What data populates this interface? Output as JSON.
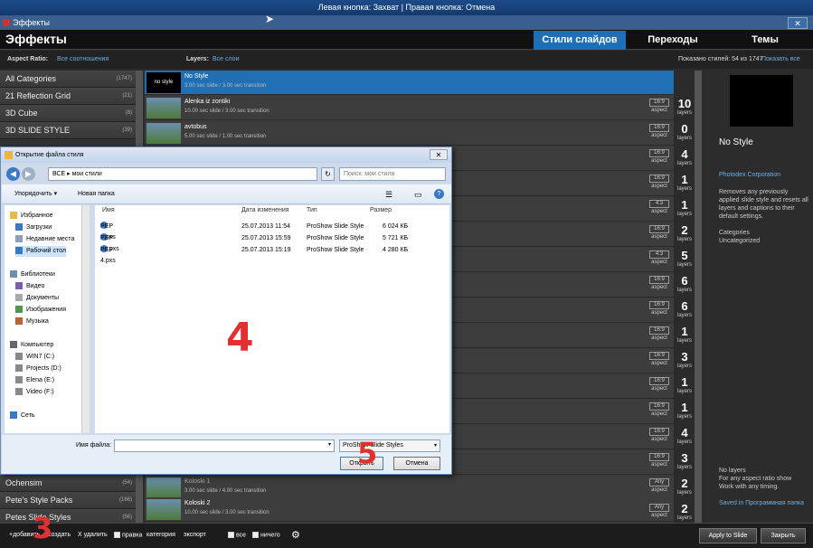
{
  "capture_banner": "Левая кнопка: Захват | Правая кнопка: Отмена",
  "window_title": "Эффекты",
  "header": {
    "title": "Эффекты",
    "tabs": [
      "Стили слайдов",
      "Переходы",
      "Темы"
    ]
  },
  "subheader": {
    "aspect_label": "Aspect Ratio:",
    "aspect_value": "Все соотношения",
    "layers_label": "Layers:",
    "layers_value": "Все слои",
    "shown_text": "Показано стилей: 54 из 1747",
    "show_all": "Показать все"
  },
  "categories": [
    {
      "label": "All Categories",
      "count": "(1747)"
    },
    {
      "label": "21 Reflection Grid",
      "count": "(21)"
    },
    {
      "label": "3D Cube",
      "count": "(8)"
    },
    {
      "label": "3D SLIDE STYLE",
      "count": "(39)"
    },
    {
      "label": "Ochensim",
      "count": "(54)"
    },
    {
      "label": "Pete's Style Packs",
      "count": "(166)"
    },
    {
      "label": "Petes Slide Styles",
      "count": "(56)"
    }
  ],
  "styles": [
    {
      "name": "No Style",
      "info": "3.00 sec slide / 3.00 sec transition",
      "thumb": "no style"
    },
    {
      "name": "Alenka iz zontiki",
      "info": "10.00 sec slide / 3.00 sec transition"
    },
    {
      "name": "avtobus",
      "info": "5.00 sec slide / 1.00 sec transition"
    },
    {
      "name": "Koloski 1",
      "info": "3.00 sec slide / 4.00 sec transition"
    },
    {
      "name": "Koloski 2",
      "info": "10.00 sec slide / 3.00 sec transition"
    }
  ],
  "layer_rows": [
    {
      "aspect": "",
      "layers": ""
    },
    {
      "aspect": "16:9",
      "layers": "10"
    },
    {
      "aspect": "16:9",
      "layers": "0"
    },
    {
      "aspect": "16:9",
      "layers": "4"
    },
    {
      "aspect": "16:9",
      "layers": "1"
    },
    {
      "aspect": "4:3",
      "layers": "1"
    },
    {
      "aspect": "16:9",
      "layers": "2"
    },
    {
      "aspect": "4:3",
      "layers": "5"
    },
    {
      "aspect": "16:9",
      "layers": "6"
    },
    {
      "aspect": "16:9",
      "layers": "6"
    },
    {
      "aspect": "16:9",
      "layers": "1"
    },
    {
      "aspect": "16:9",
      "layers": "3"
    },
    {
      "aspect": "16:9",
      "layers": "1"
    },
    {
      "aspect": "16:9",
      "layers": "1"
    },
    {
      "aspect": "16:9",
      "layers": "4"
    },
    {
      "aspect": "16:9",
      "layers": "3"
    },
    {
      "aspect": "Any",
      "layers": "2"
    },
    {
      "aspect": "Any",
      "layers": "2"
    }
  ],
  "aspect_word": "aspect",
  "layers_word": "layers",
  "preview": {
    "name": "No Style",
    "author": "Photodex Corporation",
    "description": "Removes any previously applied slide style and resets all layers and captions to their default settings.",
    "categories_label": "Categories",
    "category": "Uncategorized",
    "layers_info": [
      "No layers",
      "For any aspect ratio show",
      "Work with any timing."
    ],
    "saved": "Saved in Программная папка"
  },
  "bottom": {
    "add": "+добавить",
    "create": "+ создать",
    "delete": "X удалить",
    "edit": "правка",
    "category": "категория",
    "export": "экспорт",
    "all": "все",
    "none": "ничего",
    "apply": "Apply to Slide",
    "close": "Закрыть"
  },
  "dialog": {
    "title": "Открытие файла стиля",
    "address": "ВСЕ  ▸  мои стили",
    "search_placeholder": "Поиск: мои стили",
    "organize": "Упорядочить ▾",
    "new_folder": "Новая папка",
    "nav": [
      "Избранное",
      "Загрузки",
      "Недавние места",
      "Рабочий стол",
      "Библиотеки",
      "Видео",
      "Документы",
      "Изображения",
      "Музыка",
      "Компьютер",
      "WIN7 (C:)",
      "Projects (D:)",
      "Elena (E:)",
      "Video (F:)",
      "Сеть"
    ],
    "columns": [
      "Имя",
      "Дата изменения",
      "Тип",
      "Размер"
    ],
    "files": [
      {
        "name": "PEP 3.pxs",
        "date": "25.07.2013 11:54",
        "type": "ProShow Slide Style",
        "size": "6 024 КБ"
      },
      {
        "name": "PEP 3a.pxs",
        "date": "25.07.2013 15:59",
        "type": "ProShow Slide Style",
        "size": "5 721 КБ"
      },
      {
        "name": "PEP 4.pxs",
        "date": "25.07.2013 15:19",
        "type": "ProShow Slide Style",
        "size": "4 280 КБ"
      }
    ],
    "filename_label": "Имя файла:",
    "filetype": "ProShow Slide Styles",
    "open": "Открыть",
    "cancel": "Отмена"
  },
  "annotations": {
    "n3": "3",
    "n4": "4",
    "n5": "5"
  },
  "colors": {
    "accent": "#1f6fb5",
    "annotation": "#e23030",
    "link": "#6ab0e8"
  }
}
